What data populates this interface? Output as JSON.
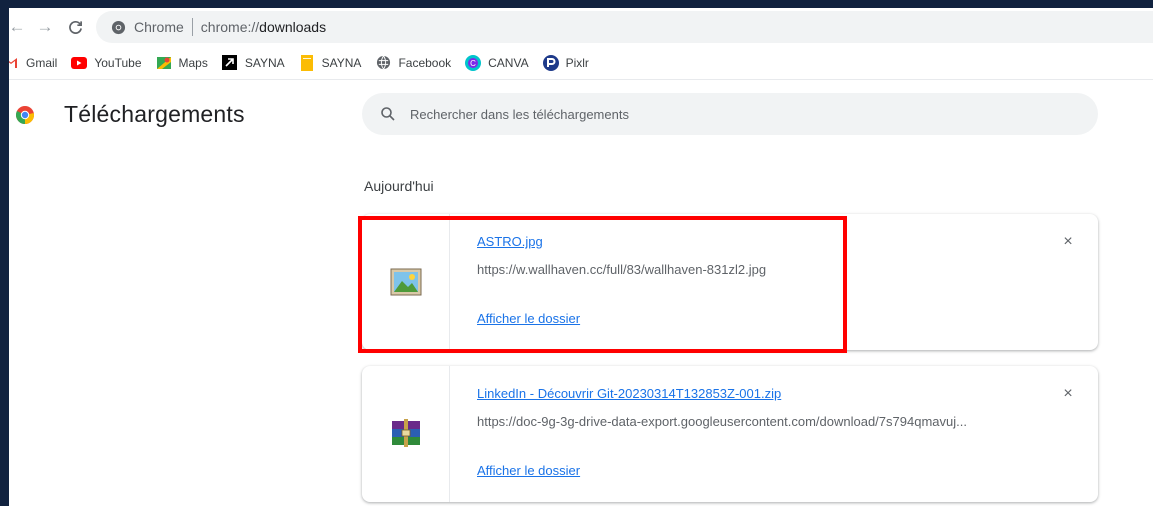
{
  "toolbar": {
    "back_icon": "←",
    "forward_icon": "→",
    "reload_icon": "C",
    "chip_label": "Chrome",
    "url_scheme": "chrome://",
    "url_host": "downloads"
  },
  "bookmarks": [
    {
      "label": "Gmail",
      "icon": "gmail-icon",
      "color": "#ea4335"
    },
    {
      "label": "YouTube",
      "icon": "youtube-icon",
      "color": "#ff0000"
    },
    {
      "label": "Maps",
      "icon": "maps-icon",
      "color": "#34a853"
    },
    {
      "label": "SAYNA",
      "icon": "sayna-icon",
      "color": "#000000"
    },
    {
      "label": "SAYNA",
      "icon": "folder-note-icon",
      "color": "#fbbc04"
    },
    {
      "label": "Facebook",
      "icon": "globe-icon",
      "color": "#5f6368"
    },
    {
      "label": "CANVA",
      "icon": "canva-icon",
      "color": "#00c4cc"
    },
    {
      "label": "Pixlr",
      "icon": "pixlr-icon",
      "color": "#1e3a8a"
    }
  ],
  "page": {
    "title": "Téléchargements",
    "search_placeholder": "Rechercher dans les téléchargements",
    "section_label": "Aujourd'hui"
  },
  "downloads": [
    {
      "file_name": "ASTRO.jpg",
      "url": "https://w.wallhaven.cc/full/83/wallhaven-831zl2.jpg",
      "show_folder": "Afficher le dossier",
      "close_icon": "×",
      "thumb_icon": "image-file-icon"
    },
    {
      "file_name": "LinkedIn - Découvrir Git-20230314T132853Z-001.zip",
      "url": "https://doc-9g-3g-drive-data-export.googleusercontent.com/download/7s794qmavuj...",
      "show_folder": "Afficher le dossier",
      "close_icon": "×",
      "thumb_icon": "winrar-archive-icon"
    }
  ],
  "colors": {
    "link": "#1a73e8",
    "highlight": "#ff0000",
    "frame": "#11223f"
  }
}
